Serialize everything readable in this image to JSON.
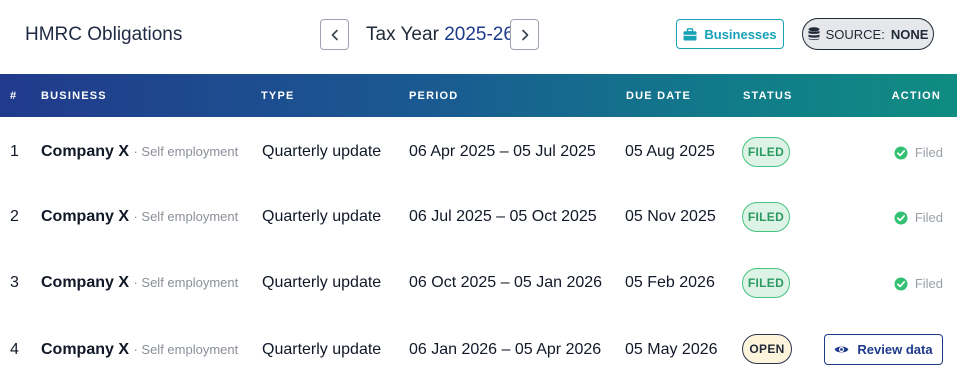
{
  "header": {
    "title": "HMRC Obligations",
    "tax_year_label": "Tax Year",
    "tax_year_value": "2025-26",
    "businesses_button": "Businesses",
    "source_label": "SOURCE:",
    "source_value": "NONE"
  },
  "table": {
    "columns": [
      "#",
      "BUSINESS",
      "TYPE",
      "PERIOD",
      "DUE DATE",
      "STATUS",
      "ACTION"
    ],
    "rows": [
      {
        "num": "1",
        "business": "Company X",
        "business_sub": "· Self employment",
        "type": "Quarterly update",
        "period": "06 Apr 2025 – 05 Jul 2025",
        "due": "05 Aug 2025",
        "status": "FILED",
        "action": "Filed"
      },
      {
        "num": "2",
        "business": "Company X",
        "business_sub": "· Self employment",
        "type": "Quarterly update",
        "period": "06 Jul 2025 – 05 Oct 2025",
        "due": "05 Nov 2025",
        "status": "FILED",
        "action": "Filed"
      },
      {
        "num": "3",
        "business": "Company X",
        "business_sub": "· Self employment",
        "type": "Quarterly update",
        "period": "06 Oct 2025 – 05 Jan 2026",
        "due": "05 Feb 2026",
        "status": "FILED",
        "action": "Filed"
      },
      {
        "num": "4",
        "business": "Company X",
        "business_sub": "· Self employment",
        "type": "Quarterly update",
        "period": "06 Jan 2026 – 05 Apr 2026",
        "due": "05 May 2026",
        "status": "OPEN",
        "action": "Review data"
      }
    ]
  },
  "colors": {
    "header_gradient_start": "#213a8c",
    "header_gradient_end": "#0f8c82",
    "accent_teal": "#17a2b8",
    "filed_green": "#2b9a60",
    "primary_navy": "#1e3a8a"
  },
  "icons": {
    "prev": "chevron-left-icon",
    "next": "chevron-right-icon",
    "businesses": "briefcase-icon",
    "source": "database-icon",
    "filed": "check-circle-icon",
    "review": "eye-icon"
  }
}
